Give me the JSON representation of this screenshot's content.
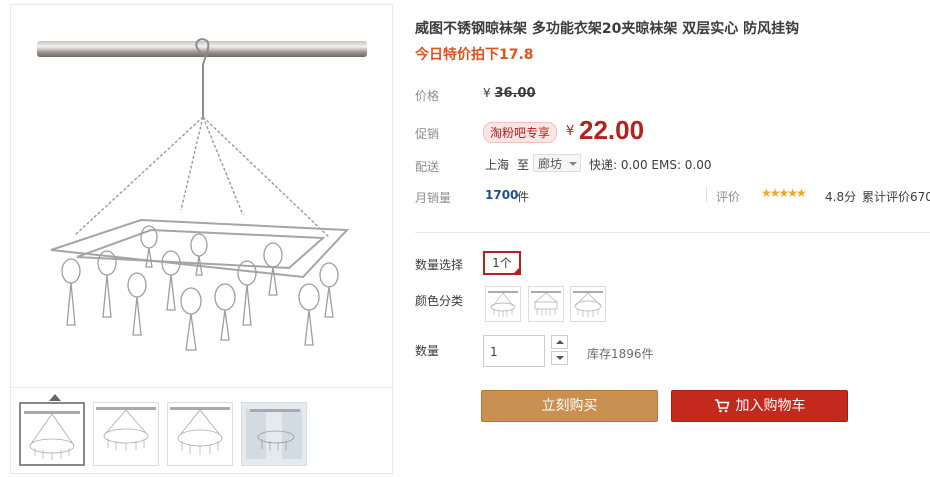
{
  "product": {
    "title": "威图不锈钢晾袜架 多功能衣架20夹晾袜架 双层实心 防风挂钩",
    "subtitle": "今日特价拍下17.8"
  },
  "price": {
    "label": "价格",
    "currency": "¥",
    "original": "36.00"
  },
  "promo": {
    "label": "促销",
    "badge": "淘粉吧专享",
    "currency": "¥",
    "price": "22.00"
  },
  "shipping": {
    "label": "配送",
    "from": "上海",
    "to_word": "至",
    "destination": "廊坊",
    "fees": "快递: 0.00 EMS: 0.00"
  },
  "sales": {
    "label": "月销量",
    "count": "1700",
    "unit": "件"
  },
  "reviews": {
    "label": "评价",
    "stars": "★★★★★",
    "score": "4.8分",
    "count_text": "累计评价670"
  },
  "options": {
    "qty_select_label": "数量选择",
    "qty_select_value": "1个",
    "color_label": "颜色分类",
    "color_swatches": [
      "rack-image-1",
      "rack-image-2",
      "rack-image-3"
    ]
  },
  "quantity": {
    "label": "数量",
    "value": "1",
    "stock": "库存1896件"
  },
  "actions": {
    "buy_now": "立刻购买",
    "add_to_cart": "加入购物车"
  },
  "colors": {
    "accent_red": "#b5211b",
    "subtitle_orange": "#e5511d",
    "buy_button": "#c99052",
    "cart_button": "#c4291d",
    "sales_blue": "#1f4e90",
    "star": "#f5a623"
  },
  "icons": {
    "cart": "shopping-cart-icon",
    "select_arrow": "chevron-down-icon",
    "stepper_up": "chevron-up-icon",
    "stepper_down": "chevron-down-icon"
  }
}
